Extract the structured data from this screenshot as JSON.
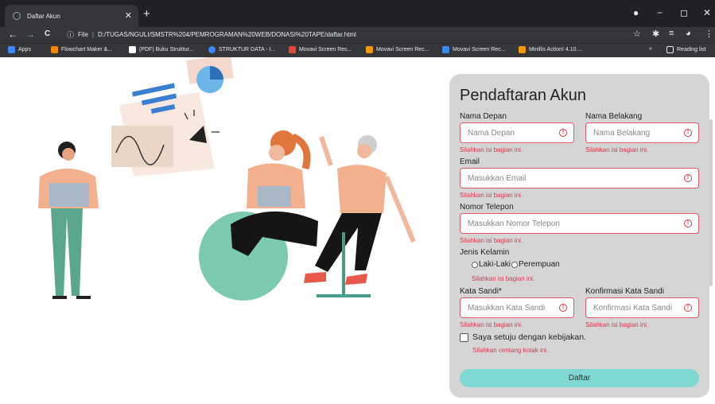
{
  "browser": {
    "tab_title": "Daftar Akun",
    "tab_close": "✕",
    "new_tab": "+",
    "window_controls": [
      "−",
      "◻",
      "✕"
    ],
    "nav": [
      "←",
      "→",
      "C"
    ],
    "url_scheme": "File",
    "url": "D:/TUGAS/NGULI/SMSTR%204/PEMROGRAMAN%20WEB/DONASI%20TAPE/daftar.html",
    "bookmarks": [
      {
        "label": "Apps",
        "color": "#4285f4"
      },
      {
        "label": "Flowchart Maker &...",
        "color": "#f08705"
      },
      {
        "label": "(PDF) Buku Struktur...",
        "color": "#ffffff"
      },
      {
        "label": "STRUKTUR DATA - I...",
        "color": "#4285f4"
      },
      {
        "label": "Movavi Screen Rec...",
        "color": "#e8453c"
      },
      {
        "label": "Movavi Screen Rec...",
        "color": "#f29900"
      },
      {
        "label": "Movavi Screen Rec...",
        "color": "#3c8ce7"
      },
      {
        "label": "Minillis Action! 4.10....",
        "color": "#f29900"
      }
    ],
    "bookmarks_more": "»",
    "reading_list": "Reading list"
  },
  "form": {
    "title": "Pendaftaran Akun",
    "first_name_label": "Nama Depan",
    "first_name_placeholder": "Nama Depan",
    "last_name_label": "Nama Belakang",
    "last_name_placeholder": "Nama Belakang",
    "email_label": "Email",
    "email_placeholder": "Masukkan Email",
    "phone_label": "Nomor Telepon",
    "phone_placeholder": "Masukkan Nomor Telepon",
    "gender_label": "Jenis Kelamin",
    "gender_options": [
      "Laki-Laki",
      "Perempuan"
    ],
    "password_label": "Kata Sandi*",
    "password_placeholder": "Masukkan Kata Sandi",
    "confirm_label": "Konfirmasi Kata Sandi",
    "confirm_placeholder": "Konfirmasi Kata Sandi",
    "agree_label": "Saya setuju dengan kebijakan.",
    "error_required": "Silahkan isi bagian ini.",
    "error_checkbox": "Silahkan centang kotak ini.",
    "submit_label": "Daftar",
    "warn_glyph": "!"
  }
}
